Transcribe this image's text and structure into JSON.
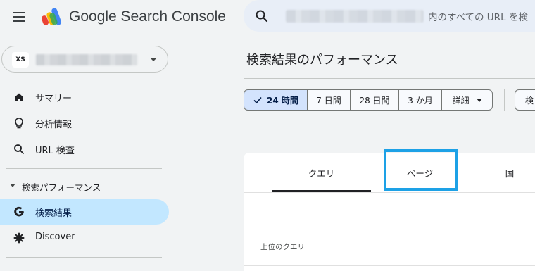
{
  "header": {
    "product_name": "Google Search Console",
    "search_placeholder": "内のすべての URL を検"
  },
  "property": {
    "badge": "XS"
  },
  "sidebar": {
    "items": [
      {
        "label": "サマリー",
        "icon": "home-icon"
      },
      {
        "label": "分析情報",
        "icon": "lightbulb-icon"
      },
      {
        "label": "URL 検査",
        "icon": "search-icon"
      }
    ],
    "section_label": "検索パフォーマンス",
    "section_items": [
      {
        "label": "検索結果",
        "icon": "google-g-icon",
        "active": true
      },
      {
        "label": "Discover",
        "icon": "asterisk-icon",
        "active": false
      }
    ]
  },
  "main": {
    "title": "検索結果のパフォーマンス",
    "ranges": [
      {
        "label": "24 時間",
        "selected": true
      },
      {
        "label": "7 日間",
        "selected": false
      },
      {
        "label": "28 日間",
        "selected": false
      },
      {
        "label": "3 か月",
        "selected": false
      },
      {
        "label": "詳細",
        "selected": false
      }
    ],
    "extra_button": "検",
    "tabs": [
      {
        "label": "クエリ",
        "selected": true
      },
      {
        "label": "ページ",
        "selected": false
      },
      {
        "label": "国",
        "selected": false
      }
    ],
    "table_heading": "上位のクエリ"
  },
  "colors": {
    "accent": "#c2e7ff",
    "selected_chip": "#d3e3fd",
    "highlight": "#1da1e6"
  }
}
